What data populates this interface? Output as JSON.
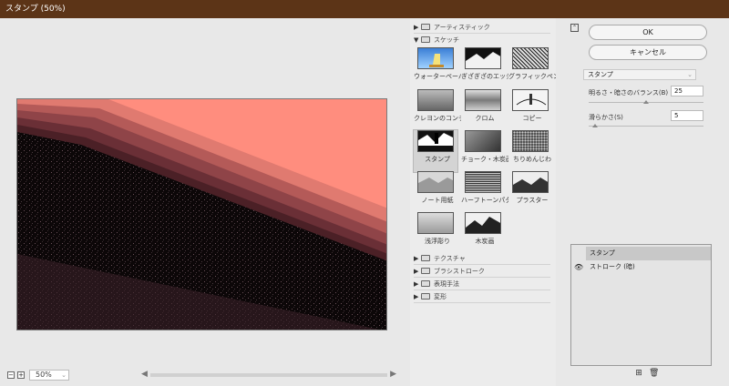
{
  "window": {
    "title": "スタンプ (50%)"
  },
  "preview": {
    "zoom": "50%",
    "zoom_out": "−",
    "zoom_in": "+"
  },
  "gallery": {
    "categories": [
      {
        "label": "アーティスティック",
        "expanded": false
      },
      {
        "label": "スケッチ",
        "expanded": true
      },
      {
        "label": "テクスチャ",
        "expanded": false
      },
      {
        "label": "ブラシストローク",
        "expanded": false
      },
      {
        "label": "表現手法",
        "expanded": false
      },
      {
        "label": "変形",
        "expanded": false
      }
    ],
    "sketch_items": [
      {
        "label": "ウォーターペーパー"
      },
      {
        "label": "ぎざぎざのエッジ"
      },
      {
        "label": "グラフィックペン"
      },
      {
        "label": "クレヨンのコンテ画"
      },
      {
        "label": "クロム"
      },
      {
        "label": "コピー"
      },
      {
        "label": "スタンプ",
        "selected": true
      },
      {
        "label": "チョーク・木炭画"
      },
      {
        "label": "ちりめんじわ"
      },
      {
        "label": "ノート用紙"
      },
      {
        "label": "ハーフトーンパターン"
      },
      {
        "label": "プラスター"
      },
      {
        "label": "浅浮彫り"
      },
      {
        "label": "木炭画"
      }
    ]
  },
  "controls": {
    "ok": "OK",
    "cancel": "キャンセル",
    "filter": "スタンプ",
    "params": [
      {
        "label": "明るさ・暗さのバランス(B)",
        "value": "25",
        "level": 0.5
      },
      {
        "label": "滑らかさ(S)",
        "value": "5",
        "level": 0.04
      }
    ]
  },
  "layers": {
    "items": [
      {
        "label": "スタンプ",
        "selected": true
      },
      {
        "label": "ストローク (暗)",
        "visible": true
      }
    ]
  }
}
